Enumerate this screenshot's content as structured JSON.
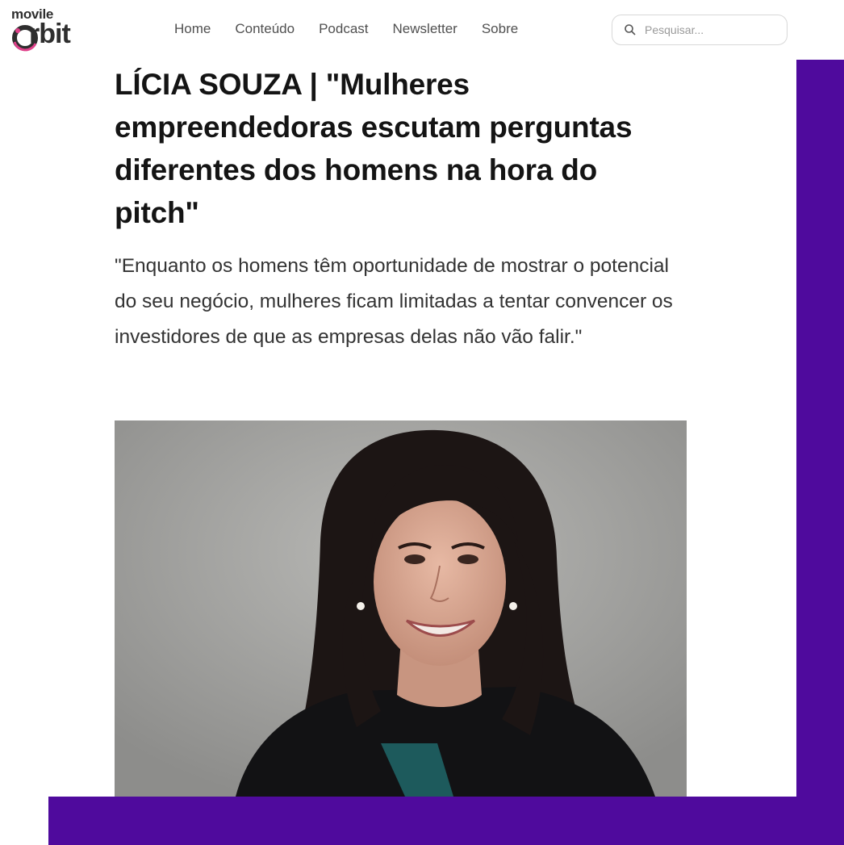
{
  "brand": {
    "logo_top": "movile",
    "logo_bottom": "rbit",
    "logo_name": "movile-orbit-logo",
    "accent_color": "#4f0a9d",
    "logo_ring_color": "#e0408a"
  },
  "nav": {
    "items": [
      {
        "label": "Home"
      },
      {
        "label": "Conteúdo"
      },
      {
        "label": "Podcast"
      },
      {
        "label": "Newsletter"
      },
      {
        "label": "Sobre"
      }
    ]
  },
  "search": {
    "placeholder": "Pesquisar...",
    "icon": "search-icon"
  },
  "article": {
    "title": "LÍCIA SOUZA | \"Mulheres empreendedoras escutam perguntas diferentes dos homens na hora do pitch\"",
    "subtitle": "\"Enquanto os homens têm oportunidade de mostrar o potencial do seu negócio, mulheres ficam limitadas a tentar convencer os investidores de que as empresas delas não vão falir.\"",
    "image": "portrait-photo"
  }
}
